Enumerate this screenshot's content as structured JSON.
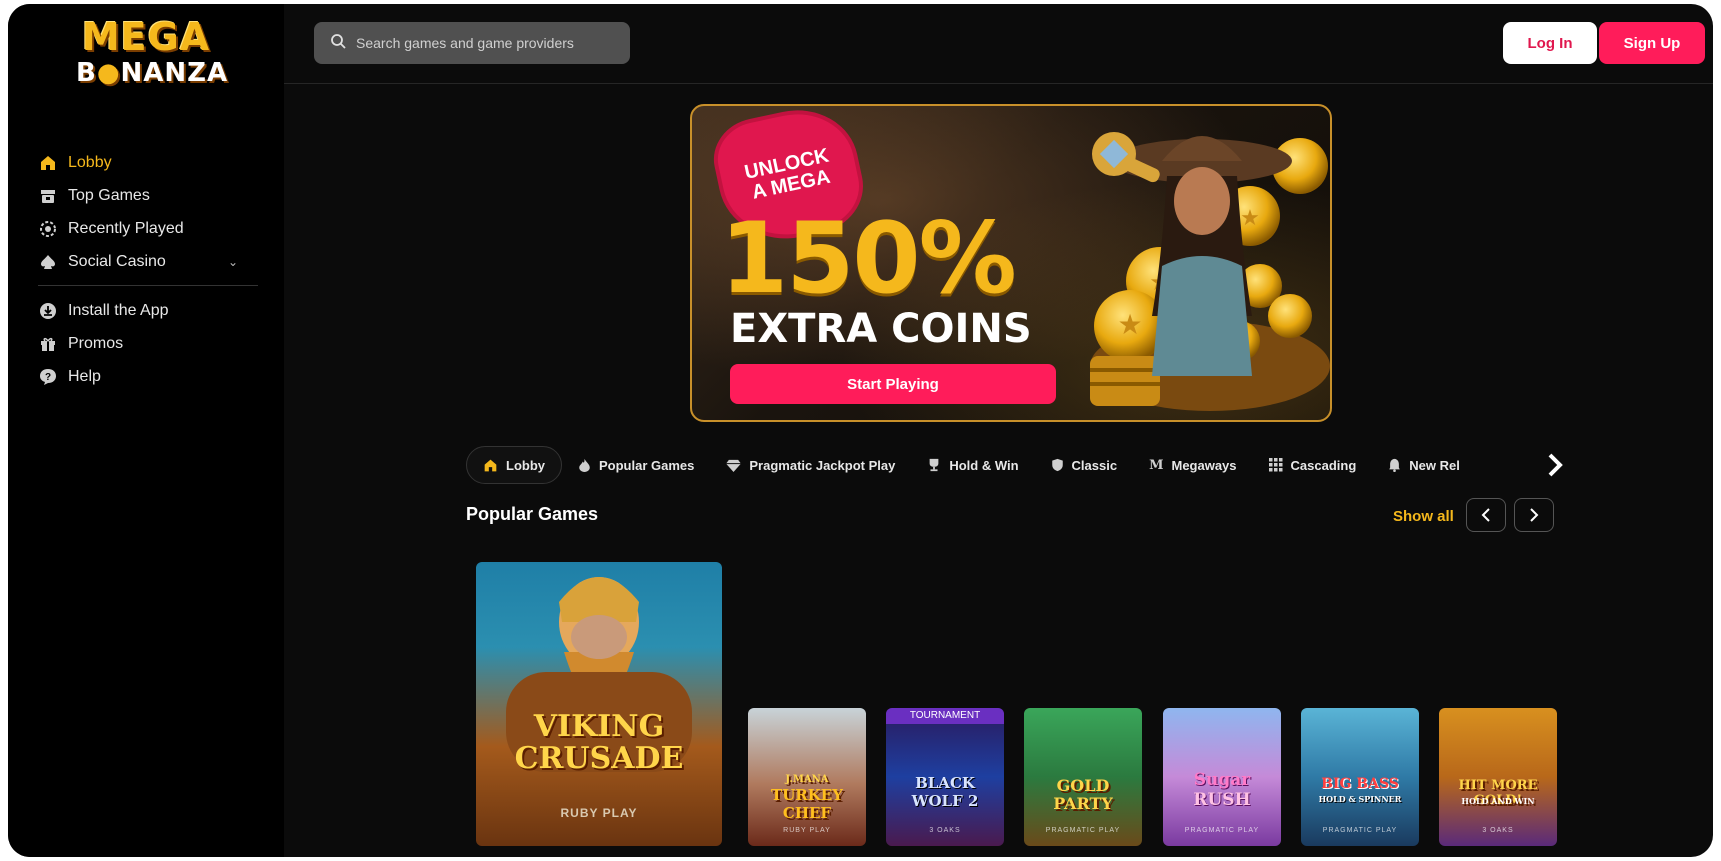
{
  "brand": {
    "logo_line1": "MEGA",
    "logo_line2_a": "B",
    "logo_line2_coin": "●",
    "logo_line2_b": "NANZA"
  },
  "sidebar": {
    "items": [
      {
        "label": "Lobby",
        "icon": "home-icon",
        "active": true
      },
      {
        "label": "Top Games",
        "icon": "trophy-icon"
      },
      {
        "label": "Recently Played",
        "icon": "history-icon"
      },
      {
        "label": "Social Casino",
        "icon": "spade-icon",
        "has_dropdown": true
      },
      {
        "label": "Install the App",
        "icon": "download-icon"
      },
      {
        "label": "Promos",
        "icon": "gift-icon"
      },
      {
        "label": "Help",
        "icon": "help-icon"
      }
    ]
  },
  "header": {
    "search_placeholder": "Search games and game providers",
    "login_label": "Log In",
    "signup_label": "Sign Up"
  },
  "banner": {
    "badge_line1": "UNLOCK",
    "badge_line2": "A MEGA",
    "percent": "150%",
    "subtitle": "EXTRA COINS",
    "cta": "Start Playing"
  },
  "tabs": [
    {
      "label": "Lobby",
      "icon": "home-icon",
      "active": true
    },
    {
      "label": "Popular Games",
      "icon": "fire-icon"
    },
    {
      "label": "Pragmatic Jackpot Play",
      "icon": "diamond-icon"
    },
    {
      "label": "Hold & Win",
      "icon": "trophy-icon"
    },
    {
      "label": "Classic",
      "icon": "shield-icon"
    },
    {
      "label": "Megaways",
      "icon": "m-icon",
      "icon_glyph": "M"
    },
    {
      "label": "Cascading",
      "icon": "grid-icon"
    },
    {
      "label": "New Rel",
      "icon": "bell-icon"
    }
  ],
  "section": {
    "title": "Popular Games",
    "show_all": "Show all"
  },
  "games": [
    {
      "name_line1": "VIKING",
      "name_line2": "CRUSADE",
      "provider": "RUBY PLAY"
    },
    {
      "name_line1": "J.MANA",
      "name_line2": "TURKEY CHEF",
      "provider": "RUBY PLAY"
    },
    {
      "name_line1": "BLACK",
      "name_line2": "WOLF 2",
      "provider": "3 OAKS",
      "badge": "TOURNAMENT"
    },
    {
      "name_line1": "GOLD",
      "name_line2": "PARTY",
      "provider": "PRAGMATIC PLAY"
    },
    {
      "name_line1": "Sugar",
      "name_line2": "RUSH",
      "provider": "PRAGMATIC PLAY"
    },
    {
      "name_line1": "BIG BASS",
      "name_line2": "HOLD & SPINNER",
      "provider": "PRAGMATIC PLAY"
    },
    {
      "name_line1": "HIT MORE GOLD!",
      "name_line2": "HOLD AND WIN",
      "provider": "3 OAKS"
    }
  ],
  "colors": {
    "accent_yellow": "#f5b81c",
    "accent_pink": "#ff1c5a",
    "background": "#0b0b0b"
  }
}
